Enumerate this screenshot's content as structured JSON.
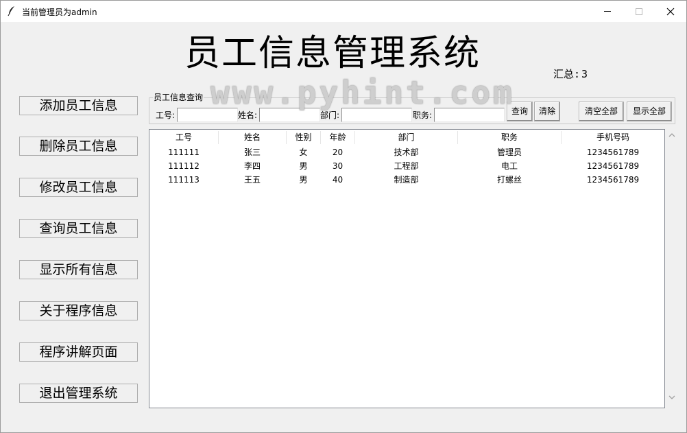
{
  "window": {
    "title": "当前管理员为admin"
  },
  "app": {
    "title": "员工信息管理系统",
    "summary_label": "汇总:",
    "summary_value": "3",
    "watermark": "www.pyhint.com"
  },
  "sidebar": {
    "items": [
      {
        "label": "添加员工信息"
      },
      {
        "label": "删除员工信息"
      },
      {
        "label": "修改员工信息"
      },
      {
        "label": "查询员工信息"
      },
      {
        "label": "显示所有信息"
      },
      {
        "label": "关于程序信息"
      },
      {
        "label": "程序讲解页面"
      },
      {
        "label": "退出管理系统"
      }
    ]
  },
  "query": {
    "legend": "员工信息查询",
    "fields": [
      {
        "label": "工号:",
        "value": ""
      },
      {
        "label": "姓名:",
        "value": ""
      },
      {
        "label": "部门:",
        "value": ""
      },
      {
        "label": "职务:",
        "value": ""
      }
    ],
    "buttons": {
      "search": "查询",
      "clear": "清除",
      "clear_all": "清空全部",
      "show_all": "显示全部"
    }
  },
  "table": {
    "columns": [
      "工号",
      "姓名",
      "性别",
      "年龄",
      "部门",
      "职务",
      "手机号码"
    ],
    "rows": [
      [
        "111111",
        "张三",
        "女",
        "20",
        "技术部",
        "管理员",
        "1234561789"
      ],
      [
        "111112",
        "李四",
        "男",
        "30",
        "工程部",
        "电工",
        "1234561789"
      ],
      [
        "111113",
        "王五",
        "男",
        "40",
        "制造部",
        "打螺丝",
        "1234561789"
      ]
    ]
  },
  "icons": {
    "app_icon": "feather-icon",
    "minimize": "minimize-icon",
    "maximize": "maximize-icon",
    "close": "close-icon",
    "scroll_up": "chevron-up-icon",
    "scroll_down": "chevron-down-icon"
  }
}
